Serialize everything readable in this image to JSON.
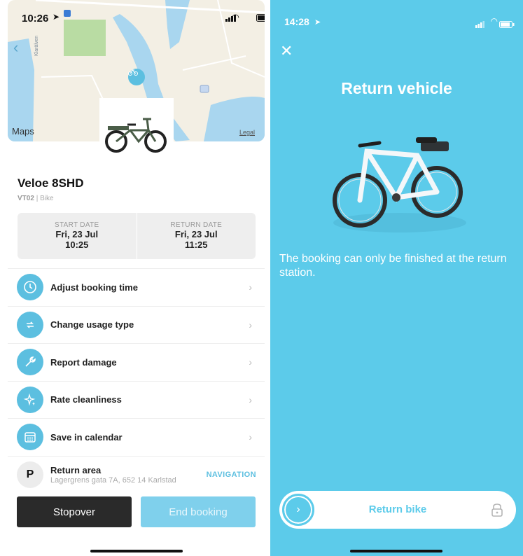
{
  "left_screen": {
    "status_time": "10:26",
    "map": {
      "maps_label": "Maps",
      "legal_label": "Legal",
      "river_label": "Klarälven"
    },
    "vehicle": {
      "name": "Veloe 8SHD",
      "code": "VT02",
      "separator": "|",
      "type": "Bike"
    },
    "start": {
      "label": "START DATE",
      "date": "Fri, 23 Jul",
      "time": "10:25"
    },
    "return_date": {
      "label": "RETURN DATE",
      "date": "Fri, 23 Jul",
      "time": "11:25"
    },
    "menu": [
      {
        "label": "Adjust booking time",
        "icon": "clock-icon"
      },
      {
        "label": "Change usage type",
        "icon": "swap-icon"
      },
      {
        "label": "Report damage",
        "icon": "wrench-icon"
      },
      {
        "label": "Rate cleanliness",
        "icon": "sparkle-icon"
      },
      {
        "label": "Save in calendar",
        "icon": "calendar-icon"
      }
    ],
    "return_area": {
      "badge": "P",
      "label": "Return area",
      "address": "Lagergrens gata 7A, 652 14 Karlstad",
      "action": "NAVIGATION"
    },
    "buttons": {
      "stopover": "Stopover",
      "end_booking": "End booking"
    }
  },
  "right_screen": {
    "status_time": "14:28",
    "title": "Return vehicle",
    "message": "The booking can only be finished at the return station.",
    "slider_label": "Return bike"
  },
  "colors": {
    "accent": "#5cbfe0",
    "right_bg": "#5ccbea",
    "dark_button": "#2a2a2a"
  }
}
